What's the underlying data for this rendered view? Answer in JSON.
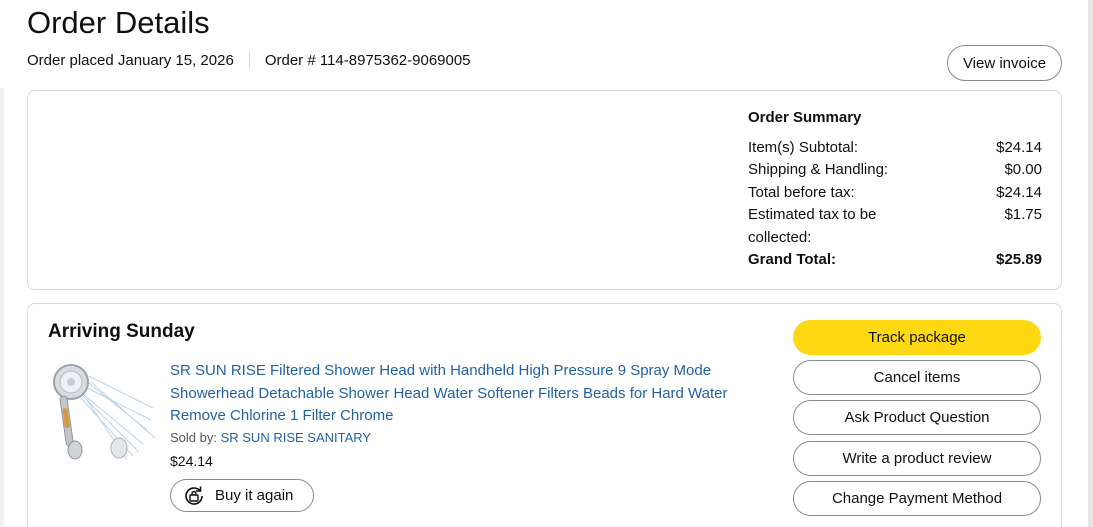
{
  "header": {
    "title": "Order Details",
    "order_placed": "Order placed January 15, 2026",
    "order_number": "Order # 114-8975362-9069005",
    "view_invoice_label": "View invoice"
  },
  "summary": {
    "title": "Order Summary",
    "rows": [
      {
        "label": "Item(s) Subtotal:",
        "value": "$24.14"
      },
      {
        "label": "Shipping & Handling:",
        "value": "$0.00"
      },
      {
        "label": "Total before tax:",
        "value": "$24.14"
      },
      {
        "label": "Estimated tax to be collected:",
        "value": "$1.75"
      }
    ],
    "grand_total_label": "Grand Total:",
    "grand_total_value": "$25.89"
  },
  "shipment": {
    "status": "Arriving Sunday",
    "product_title": "SR SUN RISE Filtered Shower Head with Handheld High Pressure 9 Spray Mode Showerhead Detachable Shower Head Water Softener Filters Beads for Hard Water Remove Chlorine 1 Filter Chrome",
    "sold_by_prefix": "Sold by: ",
    "seller": "SR SUN RISE SANITARY",
    "price": "$24.14",
    "buy_again_label": "Buy it again",
    "product_image_icon": "shower-head-product-image"
  },
  "actions": {
    "track": "Track package",
    "cancel": "Cancel items",
    "ask": "Ask Product Question",
    "review": "Write a product review",
    "payment": "Change Payment Method"
  },
  "colors": {
    "primary_button": "#ffd814",
    "link": "#2162a1",
    "border": "#d5d9d9"
  }
}
